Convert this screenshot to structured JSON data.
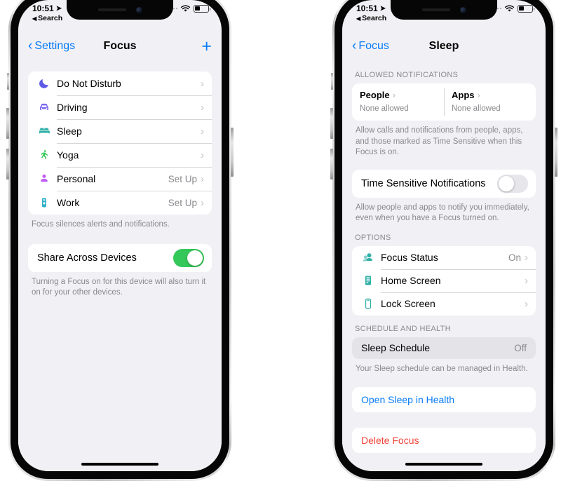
{
  "status_bar": {
    "time": "10:51",
    "location_icon": "location-arrow-icon",
    "back_to_app": "Search",
    "wifi_icon": "wifi-icon",
    "battery_icon": "battery-icon",
    "battery_level_pct": 38,
    "cellular_icon": "cellular-dots-icon"
  },
  "colors": {
    "accent_blue": "#067bf7",
    "destructive_red": "#ef453a",
    "toggle_on_green": "#34c759",
    "screen_bg": "#f1f1f5",
    "card_white": "#ffffff",
    "card_gray": "#e4e4e8",
    "secondary_text": "#8a8a8e"
  },
  "left_phone": {
    "nav": {
      "back_label": "Settings",
      "title": "Focus",
      "add_label": "+"
    },
    "focus_list": [
      {
        "label": "Do Not Disturb",
        "icon": "moon-icon",
        "icon_color": "#5e5ce6",
        "value": ""
      },
      {
        "label": "Driving",
        "icon": "car-icon",
        "icon_color": "#7b68ee",
        "value": ""
      },
      {
        "label": "Sleep",
        "icon": "bed-icon",
        "icon_color": "#30b0a8",
        "value": ""
      },
      {
        "label": "Yoga",
        "icon": "runner-icon",
        "icon_color": "#34c759",
        "value": ""
      },
      {
        "label": "Personal",
        "icon": "person-icon",
        "icon_color": "#bf5af2",
        "value": "Set Up"
      },
      {
        "label": "Work",
        "icon": "briefcase-icon",
        "icon_color": "#30b0c8",
        "value": "Set Up"
      }
    ],
    "focus_list_footer": "Focus silences alerts and notifications.",
    "share": {
      "label": "Share Across Devices",
      "toggle_state": "on",
      "footer": "Turning a Focus on for this device will also turn it on for your other devices."
    }
  },
  "right_phone": {
    "nav": {
      "back_label": "Focus",
      "title": "Sleep"
    },
    "allowed_notifications": {
      "header": "ALLOWED NOTIFICATIONS",
      "people": {
        "title": "People",
        "subtitle": "None allowed"
      },
      "apps": {
        "title": "Apps",
        "subtitle": "None allowed"
      },
      "footer": "Allow calls and notifications from people, apps, and those marked as Time Sensitive when this Focus is on."
    },
    "time_sensitive": {
      "label": "Time Sensitive Notifications",
      "toggle_state": "off",
      "footer": "Allow people and apps to notify you immediately, even when you have a Focus turned on."
    },
    "options": {
      "header": "OPTIONS",
      "items": [
        {
          "label": "Focus Status",
          "icon": "focus-status-people-icon",
          "icon_color": "#30b0a8",
          "value": "On"
        },
        {
          "label": "Home Screen",
          "icon": "home-screen-icon",
          "icon_color": "#30b0a8",
          "value": ""
        },
        {
          "label": "Lock Screen",
          "icon": "lock-screen-icon",
          "icon_color": "#30b0a8",
          "value": ""
        }
      ]
    },
    "schedule": {
      "header": "SCHEDULE AND HEALTH",
      "sleep_schedule": {
        "label": "Sleep Schedule",
        "value": "Off"
      },
      "footer": "Your Sleep schedule can be managed in Health."
    },
    "open_health_label": "Open Sleep in Health",
    "delete_focus_label": "Delete Focus"
  }
}
